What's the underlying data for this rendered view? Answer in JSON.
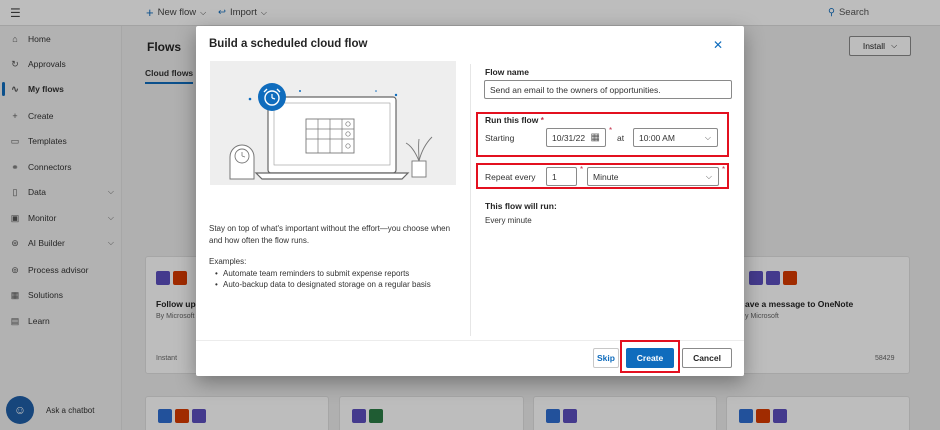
{
  "topbar": {
    "menu_icon": "hamburger-icon",
    "new_flow_label": "New flow",
    "import_label": "Import",
    "search_label": "Search"
  },
  "sidebar": {
    "items": [
      {
        "label": "Home",
        "icon": "home-icon"
      },
      {
        "label": "Approvals",
        "icon": "approvals-icon"
      },
      {
        "label": "My flows",
        "icon": "flows-icon"
      },
      {
        "label": "Create",
        "icon": "plus-icon"
      },
      {
        "label": "Templates",
        "icon": "templates-icon"
      },
      {
        "label": "Connectors",
        "icon": "connectors-icon"
      },
      {
        "label": "Data",
        "icon": "database-icon"
      },
      {
        "label": "Monitor",
        "icon": "monitor-icon"
      },
      {
        "label": "AI Builder",
        "icon": "ai-builder-icon"
      },
      {
        "label": "Process advisor",
        "icon": "process-advisor-icon"
      },
      {
        "label": "Solutions",
        "icon": "solutions-icon"
      },
      {
        "label": "Learn",
        "icon": "learn-icon"
      }
    ],
    "chatbot_label": "Ask a chatbot"
  },
  "main": {
    "title": "Flows",
    "tab": "Cloud flows",
    "install_label": "Install",
    "cards": [
      {
        "title": "Follow up",
        "publisher": "By Microsoft",
        "type": "Instant"
      },
      {
        "title": "ave a message to OneNote",
        "publisher": "y Microsoft",
        "count": "58429"
      }
    ]
  },
  "dialog": {
    "title": "Build a scheduled cloud flow",
    "description": "Stay on top of what's important without the effort—you choose when and how often the flow runs.",
    "examples_heading": "Examples:",
    "examples": [
      "Automate team reminders to submit expense reports",
      "Auto-backup data to designated storage on a regular basis"
    ],
    "flow_name_label": "Flow name",
    "flow_name_value": "Send an email to the owners of opportunities.",
    "run_label": "Run this flow",
    "required_mark": "*",
    "starting_label": "Starting",
    "start_date": "10/31/22",
    "at_label": "at",
    "start_time": "10:00 AM",
    "repeat_label": "Repeat every",
    "repeat_value": "1",
    "repeat_unit": "Minute",
    "will_run_label": "This flow will run:",
    "will_run_value": "Every minute",
    "skip_label": "Skip",
    "create_label": "Create",
    "cancel_label": "Cancel"
  },
  "colors": {
    "accent": "#0f6cbd",
    "highlight": "#e3101f",
    "required": "#c4314b"
  }
}
